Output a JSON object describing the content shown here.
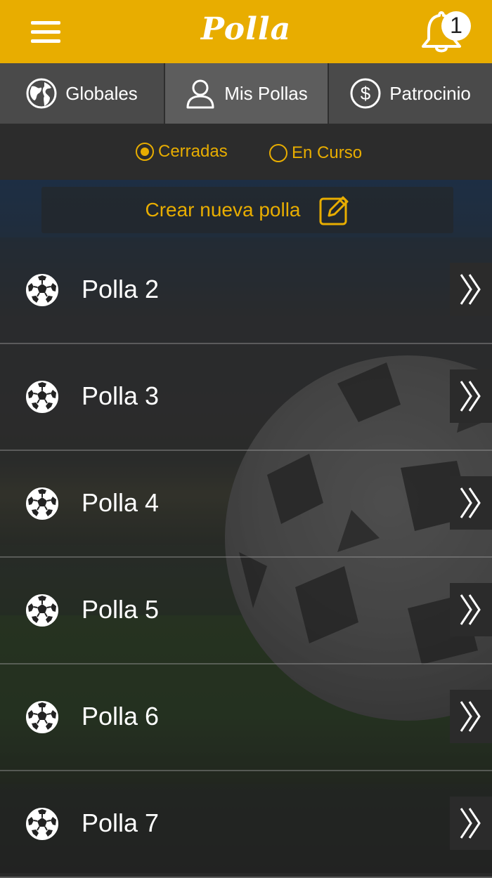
{
  "header": {
    "title": "Polla",
    "notification_count": "1",
    "menu_icon": "hamburger-menu-icon",
    "bell_icon": "bell-icon"
  },
  "tabs": [
    {
      "label": "Globales",
      "icon": "globe-icon",
      "active": false
    },
    {
      "label": "Mis Pollas",
      "icon": "user-icon",
      "active": true
    },
    {
      "label": "Patrocinio",
      "icon": "dollar-icon",
      "active": false
    }
  ],
  "filter": {
    "options": [
      {
        "label": "Cerradas",
        "selected": true
      },
      {
        "label": "En Curso",
        "selected": false
      }
    ]
  },
  "create_button": {
    "label": "Crear nueva polla",
    "icon": "edit-icon"
  },
  "list": {
    "items": [
      {
        "name": "Polla 2"
      },
      {
        "name": "Polla 3"
      },
      {
        "name": "Polla 4"
      },
      {
        "name": "Polla 5"
      },
      {
        "name": "Polla 6"
      },
      {
        "name": "Polla 7"
      }
    ]
  },
  "colors": {
    "accent": "#e8ad00",
    "tab_bg": "#4a4a4a",
    "tab_active_bg": "#5d5d5d"
  }
}
